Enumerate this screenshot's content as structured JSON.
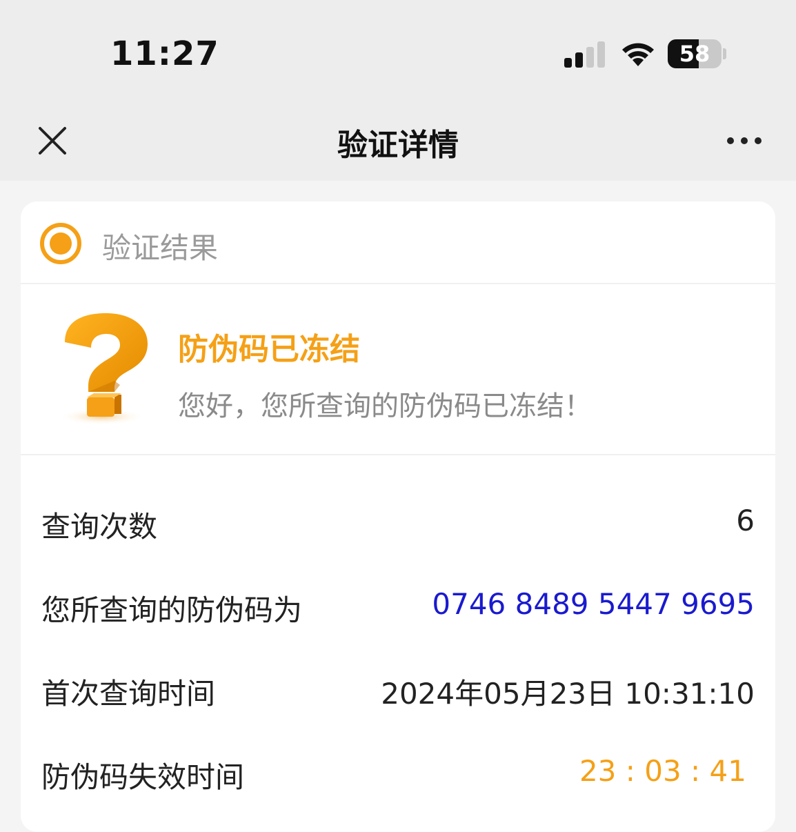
{
  "status_bar": {
    "time": "11:27",
    "battery_percent": "58",
    "battery_level": 0.58,
    "signal_bars_active": 2,
    "signal_bars_total": 4
  },
  "nav": {
    "title": "验证详情",
    "close_icon": "close-icon",
    "more_icon": "more-icon"
  },
  "card": {
    "header_label": "验证结果",
    "result": {
      "title": "防伪码已冻结",
      "description": "您好，您所查询的防伪码已冻结！"
    },
    "rows": [
      {
        "label": "查询次数",
        "value": "6"
      },
      {
        "label": "您所查询的防伪码为",
        "value": "0746 8489 5447 9695"
      },
      {
        "label": "首次查询时间",
        "value": "2024年05月23日 10:31:10"
      },
      {
        "label": "防伪码失效时间",
        "value": "23 : 03 : 41"
      }
    ]
  },
  "colors": {
    "accent": "#f5a016",
    "code_blue": "#1a1acf",
    "muted_text": "#8a8a8a",
    "background": "#ededed"
  }
}
